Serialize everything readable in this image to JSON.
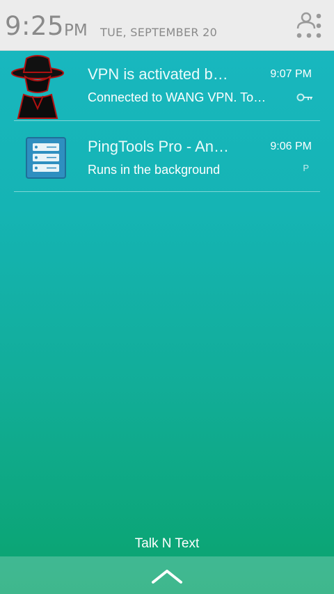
{
  "status_bar": {
    "time": "9:25",
    "ampm": "PM",
    "date": "TUE, SEPTEMBER 20",
    "settings_icon": "quick-settings-icon"
  },
  "notifications": [
    {
      "title": "VPN is activated b…",
      "subtitle": "Connected to WANG VPN. To…",
      "time": "9:07 PM",
      "app_icon": "hat-spy-icon",
      "small_icon": "key-icon"
    },
    {
      "title": "PingTools Pro - An…",
      "subtitle": "Runs in the background",
      "time": "9:06 PM",
      "app_icon": "server-icon",
      "small_icon": "p-icon",
      "small_icon_text": "P"
    }
  ],
  "carrier": "Talk N Text",
  "colors": {
    "status_bg": "#ececec",
    "gradient_top": "#1ab8c2",
    "gradient_bottom": "#0aa36d"
  }
}
